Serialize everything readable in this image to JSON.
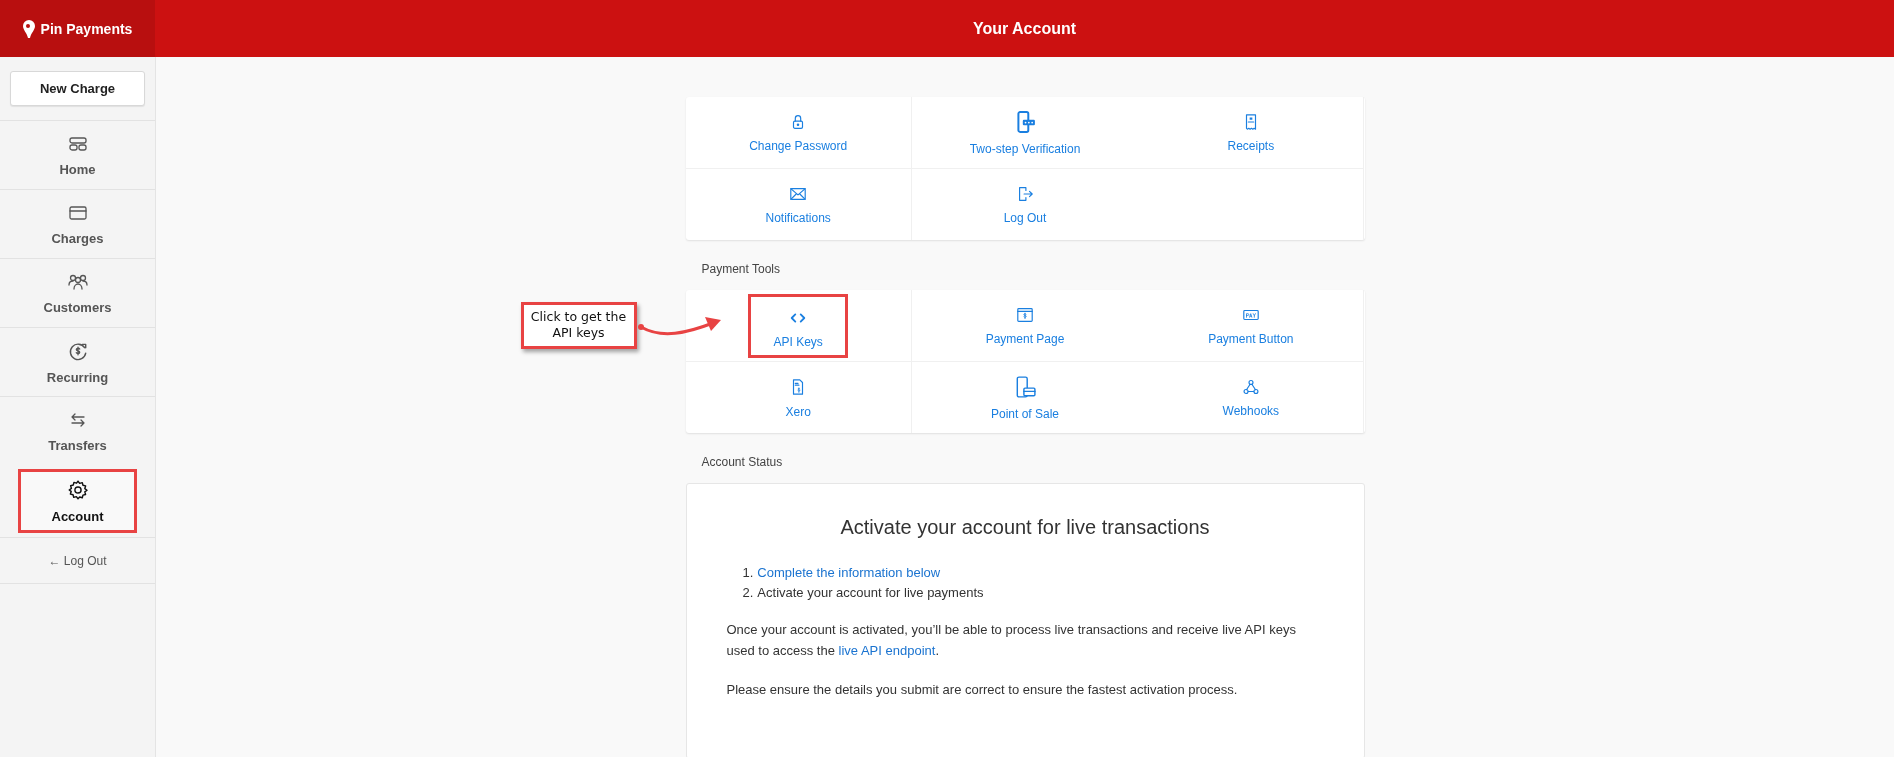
{
  "header": {
    "logo": "Pin Payments",
    "title": "Your Account"
  },
  "sidebar": {
    "new_charge": "New Charge",
    "items": [
      {
        "label": "Home",
        "selected": false,
        "highlighted": false
      },
      {
        "label": "Charges",
        "selected": false,
        "highlighted": false
      },
      {
        "label": "Customers",
        "selected": false,
        "highlighted": false
      },
      {
        "label": "Recurring",
        "selected": false,
        "highlighted": false
      },
      {
        "label": "Transfers",
        "selected": false,
        "highlighted": false
      },
      {
        "label": "Account",
        "selected": true,
        "highlighted": true
      }
    ],
    "logout": "← Log Out"
  },
  "account_links": [
    {
      "label": "Change Password",
      "highlighted": false
    },
    {
      "label": "Two-step Verification",
      "highlighted": false
    },
    {
      "label": "Receipts",
      "highlighted": false
    },
    {
      "label": "Notifications",
      "highlighted": false
    },
    {
      "label": "Log Out",
      "highlighted": false
    }
  ],
  "payment_tools": {
    "heading": "Payment Tools",
    "tiles": [
      {
        "label": "API Keys",
        "highlighted": true
      },
      {
        "label": "Payment Page",
        "highlighted": false
      },
      {
        "label": "Payment Button",
        "highlighted": false
      },
      {
        "label": "Xero",
        "highlighted": false
      },
      {
        "label": "Point of Sale",
        "highlighted": false
      },
      {
        "label": "Webhooks",
        "highlighted": false
      }
    ]
  },
  "callout": {
    "text": "Click to get the API keys"
  },
  "account_status": {
    "heading": "Account Status",
    "title": "Activate your account for live transactions",
    "steps": [
      {
        "kind": "link",
        "number": "1.",
        "text": "Complete the information below"
      },
      {
        "kind": "text",
        "number": "2.",
        "text": "Activate your account for live payments"
      }
    ],
    "paragraph": {
      "before": "Once your account is activated, you’ll be able to process live transactions and receive live API keys used to access the ",
      "link": "live API endpoint",
      "after": "."
    },
    "note": "Please ensure the details you submit are correct to ensure the fastest activation process."
  }
}
